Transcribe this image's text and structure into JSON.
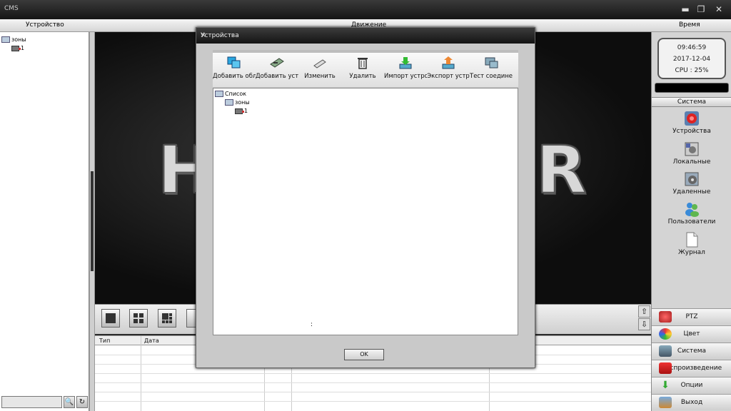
{
  "window": {
    "title": "CMS"
  },
  "header": {
    "device_label": "Устройство",
    "motion_label": "Движение",
    "time_label": "Время"
  },
  "left_tree": {
    "root": "зоны",
    "child": "1"
  },
  "video": {
    "logo_left": "H",
    "logo_right": "R"
  },
  "log_table": {
    "columns": [
      "Тип",
      "Дата"
    ]
  },
  "right_panel": {
    "time": "09:46:59",
    "date": "2017-12-04",
    "cpu": "CPU : 25%",
    "system_header": "Система",
    "items": [
      {
        "label": "Устройства",
        "icon": "devices-icon"
      },
      {
        "label": "Локальные",
        "icon": "local-config-icon"
      },
      {
        "label": "Удаленные",
        "icon": "remote-config-icon"
      },
      {
        "label": "Пользователи",
        "icon": "users-icon"
      },
      {
        "label": "Журнал",
        "icon": "log-icon"
      }
    ],
    "bottom_buttons": [
      {
        "label": "PTZ",
        "icon": "ptz-icon"
      },
      {
        "label": "Цвет",
        "icon": "color-icon"
      },
      {
        "label": "Система",
        "icon": "system-icon"
      },
      {
        "label": "Воспроизведение",
        "icon": "playback-icon"
      },
      {
        "label": "Опции",
        "icon": "options-icon"
      },
      {
        "label": "Выход",
        "icon": "exit-icon"
      }
    ]
  },
  "modal": {
    "title": "Устройства",
    "toolbar": [
      {
        "label": "Добавить обл",
        "icon": "add-area-icon"
      },
      {
        "label": "Добавить устр",
        "icon": "add-device-icon"
      },
      {
        "label": "Изменить",
        "icon": "edit-icon"
      },
      {
        "label": "Удалить",
        "icon": "delete-icon"
      },
      {
        "label": "Импорт устро",
        "icon": "import-icon"
      },
      {
        "label": "Экспорт устр",
        "icon": "export-icon"
      },
      {
        "label": "Тест соединени",
        "icon": "test-connection-icon"
      }
    ],
    "tree": {
      "root": "Список",
      "zone": "зоны",
      "device": "1"
    },
    "stray_char": ":",
    "ok_label": "OK"
  },
  "colors": {
    "accent_dark": "#151515",
    "panel_gray": "#d4d4d4"
  }
}
